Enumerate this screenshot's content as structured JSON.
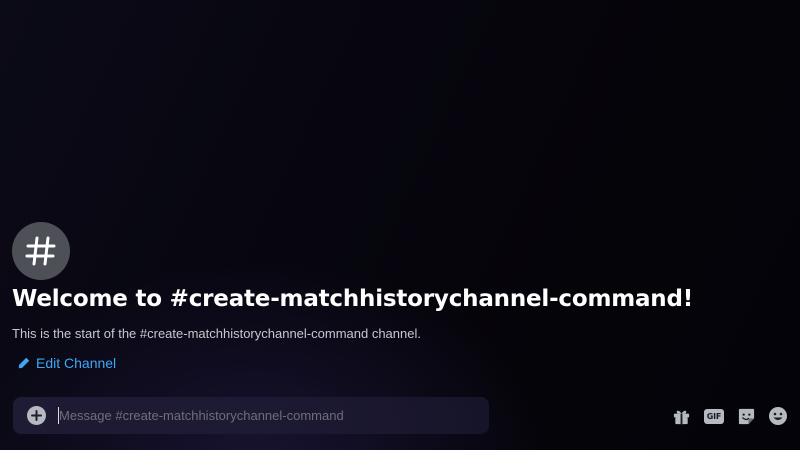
{
  "channel": {
    "icon": "hash-icon",
    "welcome_title": "Welcome to #create-matchhistorychannel-command!",
    "welcome_description": "This is the start of the #create-matchhistorychannel-command channel.",
    "edit_label": "Edit Channel"
  },
  "composer": {
    "placeholder": "Message #create-matchhistorychannel-command",
    "value": "",
    "add_icon": "plus-circle-icon"
  },
  "toolbar": {
    "gift_icon": "gift-icon",
    "gif_label": "GIF",
    "sticker_icon": "sticker-icon",
    "emoji_icon": "emoji-icon"
  },
  "colors": {
    "link": "#3ea7f4",
    "icon_bg": "#4e5058",
    "icon_fg": "#b5bac1"
  }
}
